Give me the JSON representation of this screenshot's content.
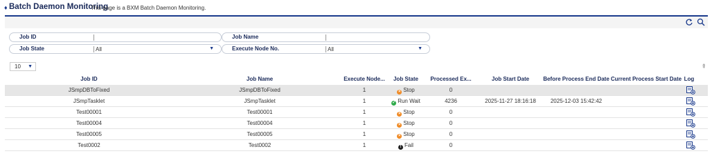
{
  "header": {
    "title": "Batch Daemon Monitoring",
    "description": "This page is a BXM Batch Daemon Monitoring."
  },
  "toolbar": {
    "icons": [
      "refresh-icon",
      "search-icon"
    ]
  },
  "search": {
    "job_id_label": "Job ID",
    "job_id_value": "",
    "job_name_label": "Job Name",
    "job_name_value": "",
    "job_state_label": "Job State",
    "job_state_value": "All",
    "exec_node_label": "Execute Node No.",
    "exec_node_value": "All"
  },
  "pager": {
    "page_size": "10"
  },
  "grid": {
    "columns": [
      "Job ID",
      "Job Name",
      "Execute Node...",
      "Job State",
      "Processed Ex...",
      "Job Start Date",
      "Before Process End Date",
      "Current Process Start Date",
      "Log"
    ],
    "rows": [
      {
        "job_id": "JSmpDBToFixed",
        "job_name": "JSmpDBToFixed",
        "node": "1",
        "state": "Stop",
        "state_kind": "stop",
        "processed": "0",
        "start": "",
        "before_end": "",
        "current_start": "",
        "selected": true
      },
      {
        "job_id": "JSmpTasklet",
        "job_name": "JSmpTasklet",
        "node": "1",
        "state": "Run Wait",
        "state_kind": "run",
        "processed": "4236",
        "start": "2025-11-27 18:16:18",
        "before_end": "2025-12-03 15:42:42",
        "current_start": "",
        "selected": false
      },
      {
        "job_id": "Test00001",
        "job_name": "Test00001",
        "node": "1",
        "state": "Stop",
        "state_kind": "stop",
        "processed": "0",
        "start": "",
        "before_end": "",
        "current_start": "",
        "selected": false
      },
      {
        "job_id": "Test00004",
        "job_name": "Test00004",
        "node": "1",
        "state": "Stop",
        "state_kind": "stop",
        "processed": "0",
        "start": "",
        "before_end": "",
        "current_start": "",
        "selected": false
      },
      {
        "job_id": "Test00005",
        "job_name": "Test00005",
        "node": "1",
        "state": "Stop",
        "state_kind": "stop",
        "processed": "0",
        "start": "",
        "before_end": "",
        "current_start": "",
        "selected": false
      },
      {
        "job_id": "Test0002",
        "job_name": "Test0002",
        "node": "1",
        "state": "Fail",
        "state_kind": "fail",
        "processed": "0",
        "start": "",
        "before_end": "",
        "current_start": "",
        "selected": false
      }
    ]
  },
  "colors": {
    "accent": "#1a3a8c",
    "stop": "#f08a24",
    "run": "#2eaa4a",
    "fail": "#222222"
  }
}
